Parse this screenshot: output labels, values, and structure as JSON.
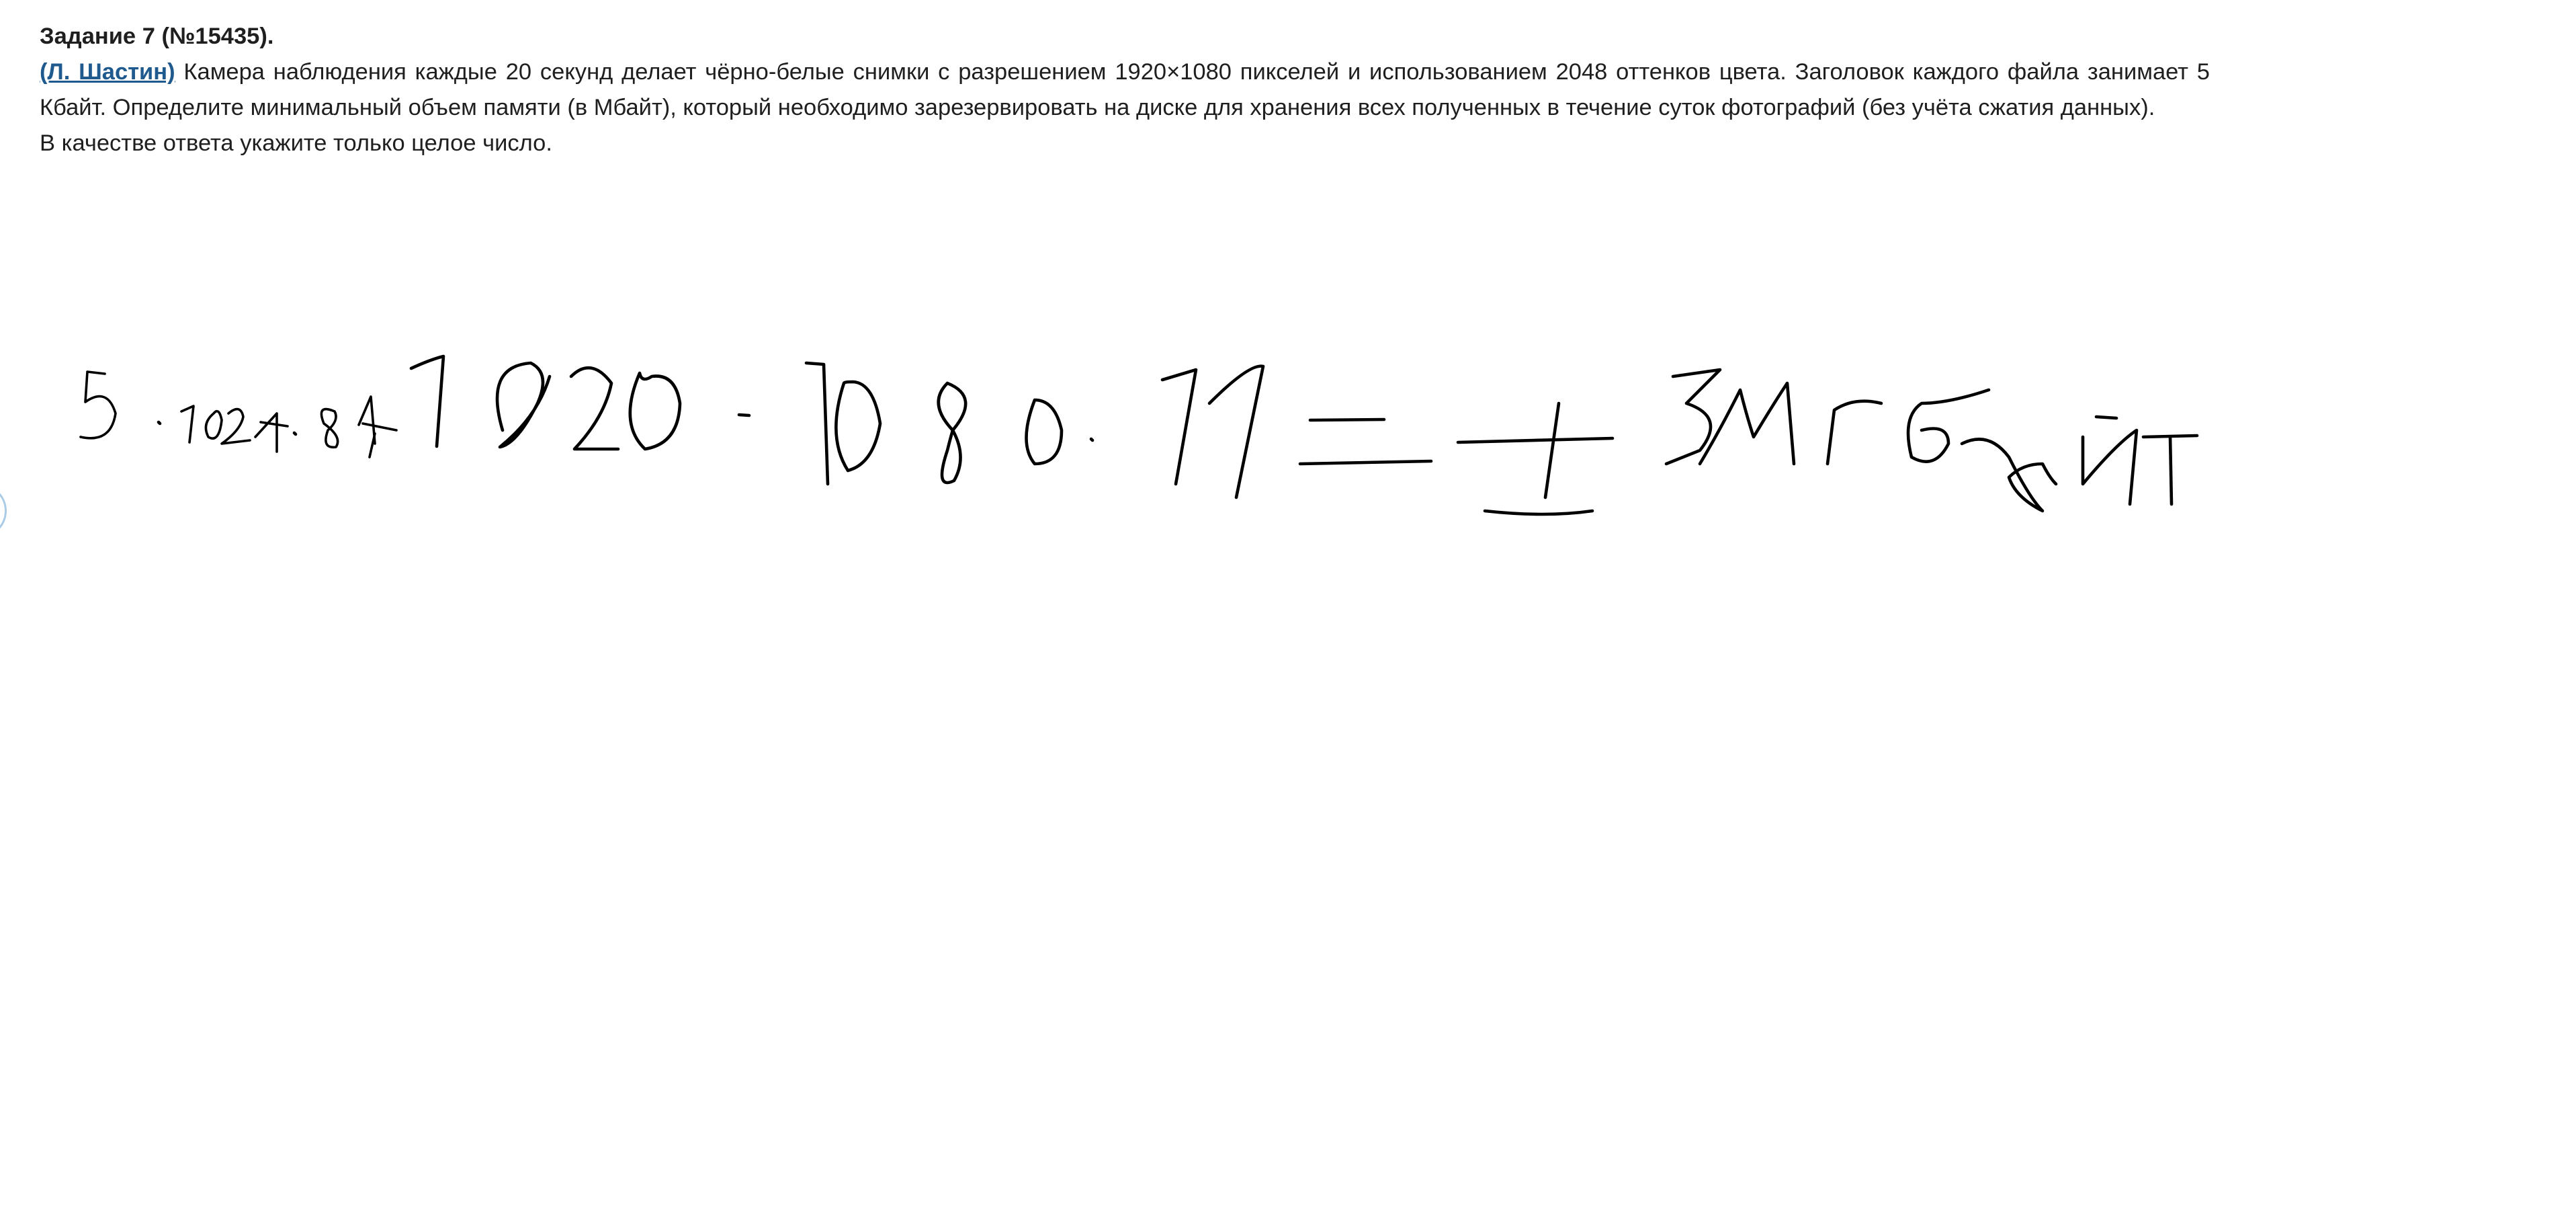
{
  "task": {
    "title": "Задание 7 (№15435).",
    "author_link": "(Л. Шастин)",
    "body": " Камера наблюдения каждые 20 секунд делает чёрно-белые снимки с разрешением 1920×1080 пикселей и использованием 2048 оттенков цвета. Заголовок каждого файла занимает 5 Кбайт. Определите минимальный объем памяти (в Мбайт), который необходимо зарезервировать на диске для хранения всех полученных в течение суток фотографий (без учёта сжатия данных).",
    "note": "В качестве ответа укажите только целое число."
  },
  "handwriting": {
    "expression": "5·1024·8+1920·1080·11=±3Мгбайт"
  }
}
